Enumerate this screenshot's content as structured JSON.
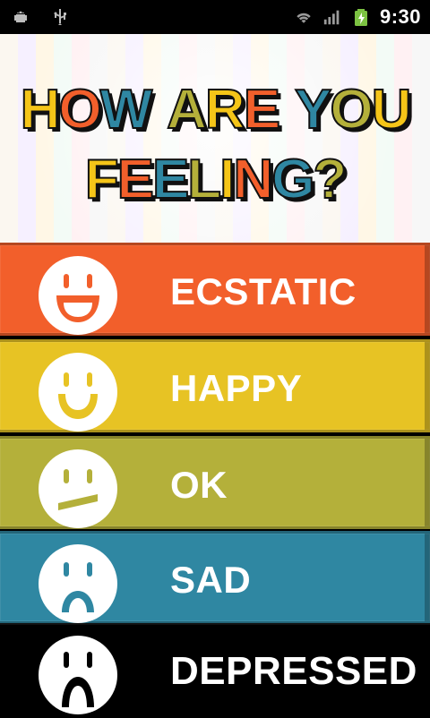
{
  "status_bar": {
    "time": "9:30",
    "left_icons": [
      "android-debug-icon",
      "usb-icon"
    ],
    "right_icons": [
      "wifi-icon",
      "signal-icon",
      "battery-charging-icon"
    ]
  },
  "header": {
    "title_line1": "HOW ARE YOU",
    "title_line2": "FEELING?",
    "title_colors": [
      "#f5c518",
      "#f25f2b",
      "#2f87a2",
      "#b4b03a"
    ]
  },
  "moods": [
    {
      "label": "ECSTATIC",
      "color": "#f25f2b",
      "face": "ecstatic-face-icon"
    },
    {
      "label": "HAPPY",
      "color": "#e7c324",
      "face": "happy-face-icon"
    },
    {
      "label": "OK",
      "color": "#b4b03a",
      "face": "ok-face-icon"
    },
    {
      "label": "SAD",
      "color": "#2f87a2",
      "face": "sad-face-icon"
    },
    {
      "label": "DEPRESSED",
      "color": "#000000",
      "face": "depressed-face-icon"
    }
  ]
}
